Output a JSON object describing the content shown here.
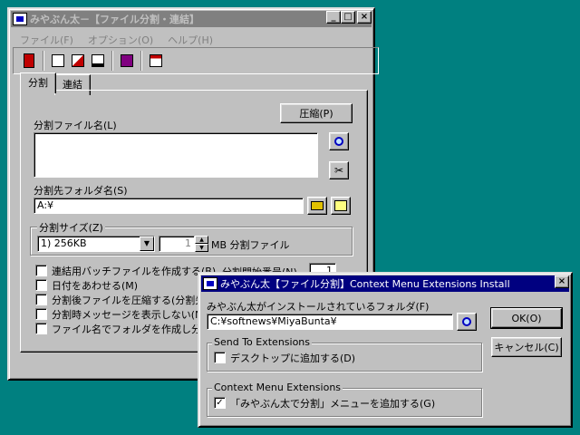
{
  "main_window": {
    "title": "みやぶん太－【ファイル分割・連結】",
    "caption_buttons": [
      "_",
      "□",
      "×"
    ],
    "menu": [
      "ファイル(F)",
      "オプション(O)",
      "ヘルプ(H)"
    ],
    "toolbar_icons": [
      "exit-icon",
      "open-icon",
      "copy-icon",
      "save-icon",
      "book-icon",
      "window-icon"
    ],
    "tabs": [
      "分割",
      "連結"
    ],
    "compress_button": "圧縮(P)",
    "split_file_label": "分割ファイル名(L)",
    "split_file_value": "",
    "dest_folder_label": "分割先フォルダ名(S)",
    "dest_folder_value": "A:¥",
    "split_size_label": "分割サイズ(Z)",
    "split_size_value": "1) 256KB",
    "count_value": "1",
    "count_unit": "MB 分割ファイル",
    "start_number_label": "分割開始番号(N)",
    "start_number_value": "1",
    "options": [
      {
        "label": "連結用バッチファイルを作成する(B)",
        "checked": false
      },
      {
        "label": "日付をあわせる(M)",
        "checked": false
      },
      {
        "label": "分割後ファイルを圧縮する(分割先が",
        "checked": false
      },
      {
        "label": "分割時メッセージを表示しない(N)",
        "checked": false
      },
      {
        "label": "ファイル名でフォルダを作成し分割する",
        "checked": false
      }
    ]
  },
  "dialog": {
    "title": "みやぶん太【ファイル分割】Context Menu Extensions Install",
    "close": "×",
    "folder_label": "みやぶん太がインストールされているフォルダ(F)",
    "folder_value": "C:¥softnews¥MiyaBunta¥",
    "ok_button": "OK(O)",
    "cancel_button": "キャンセル(C)",
    "send_to_group": "Send To Extensions",
    "send_to_option": {
      "label": "デスクトップに追加する(D)",
      "checked": false
    },
    "context_group": "Context Menu Extensions",
    "context_option": {
      "label": "「みやぶん太で分割」メニューを追加する(G)",
      "checked": true
    }
  }
}
